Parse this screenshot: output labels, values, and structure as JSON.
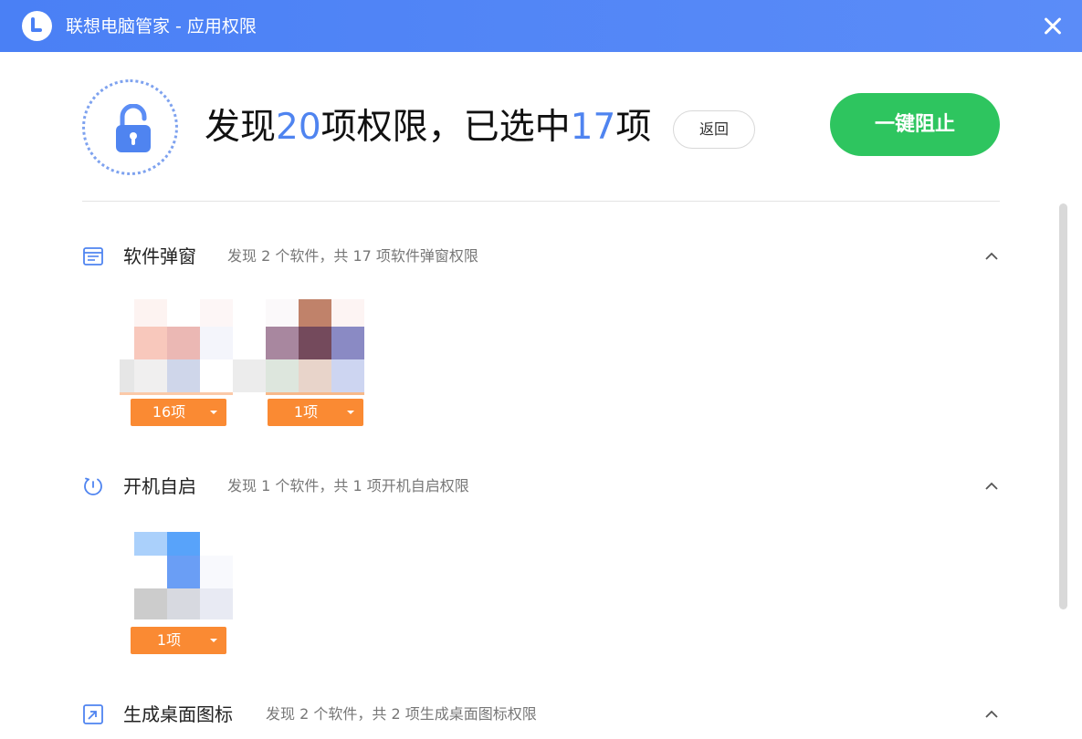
{
  "window": {
    "title": "联想电脑管家 - 应用权限",
    "accent_color": "#4a80f5"
  },
  "header": {
    "found_prefix": "发现",
    "found_count": "20",
    "found_mid": "项权限，已选中",
    "selected_count": "17",
    "found_suffix": "项",
    "back_label": "返回",
    "block_all_label": "一键阻止",
    "block_color": "#2ec55f"
  },
  "sections": [
    {
      "title": "软件弹窗",
      "description": "发现 2 个软件，共 17 项软件弹窗权限",
      "icon": "popup-window-icon",
      "apps": [
        {
          "count_label": "16项"
        },
        {
          "count_label": "1项"
        }
      ]
    },
    {
      "title": "开机自启",
      "description": "发现 1 个软件，共 1 项开机自启权限",
      "icon": "power-startup-icon",
      "apps": [
        {
          "count_label": "1项"
        }
      ]
    },
    {
      "title": "生成桌面图标",
      "description": "发现 2 个软件，共 2 项生成桌面图标权限",
      "icon": "desktop-shortcut-icon",
      "apps": []
    }
  ]
}
